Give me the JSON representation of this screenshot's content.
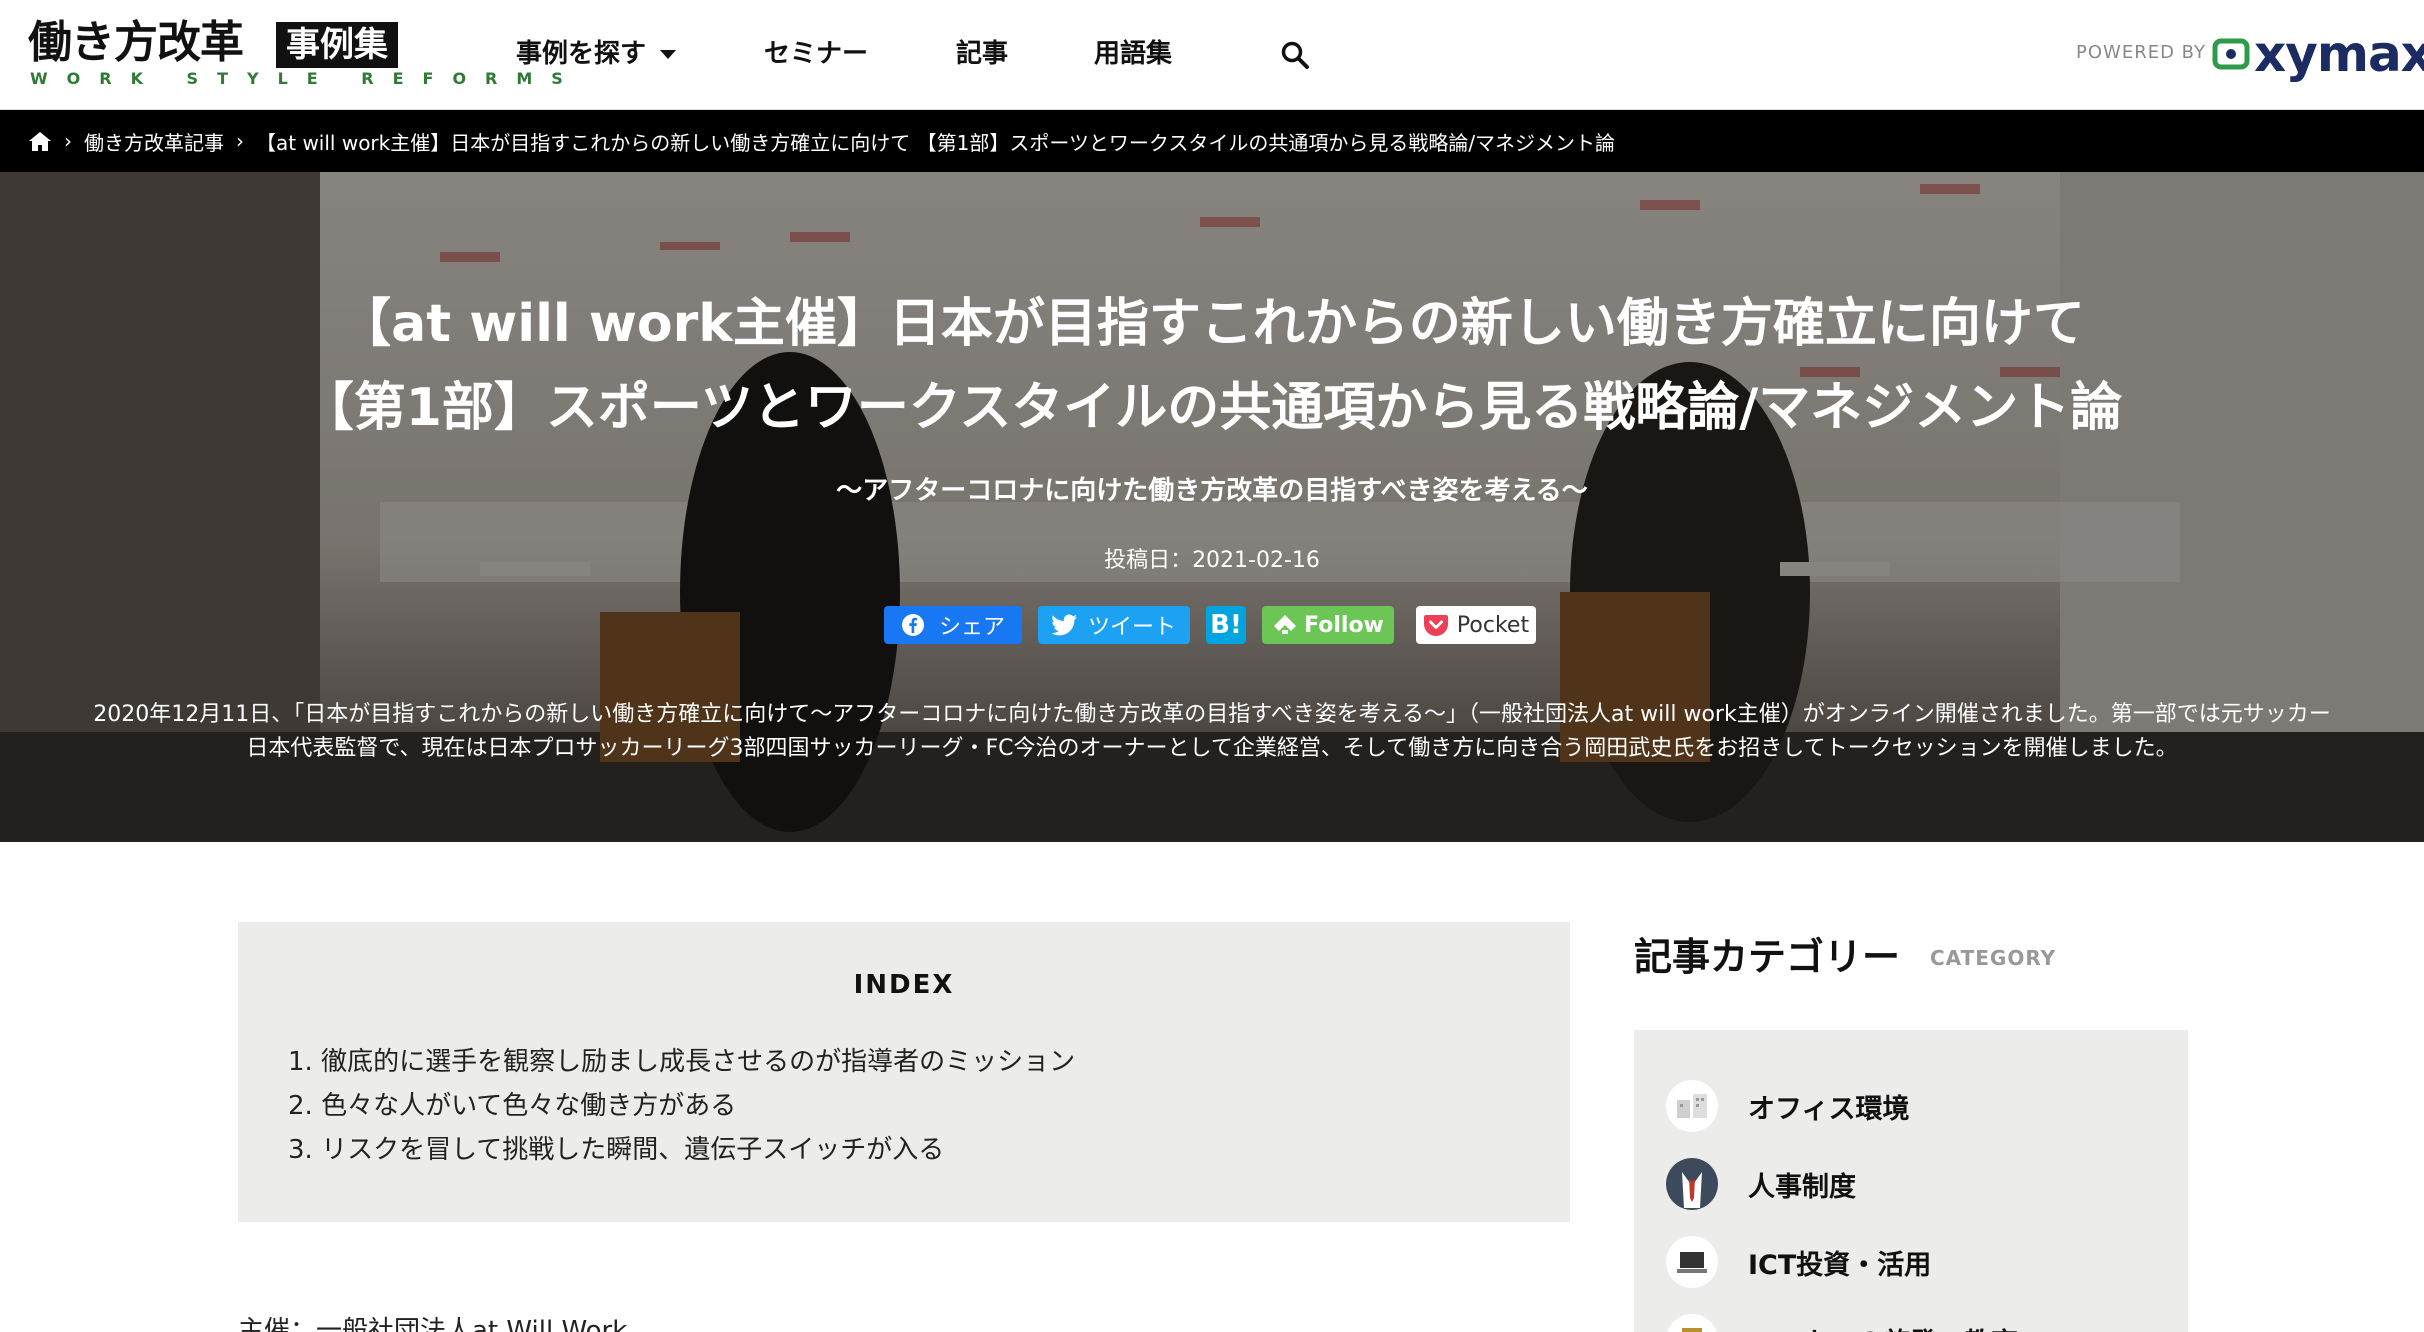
{
  "header": {
    "logo_main": "働き方改革",
    "logo_badge": "事例集",
    "logo_sub": "WORK STYLE REFORMS",
    "nav": [
      {
        "label": "事例を探す",
        "has_dropdown": true
      },
      {
        "label": "セミナー"
      },
      {
        "label": "記事"
      },
      {
        "label": "用語集"
      }
    ],
    "search_icon": "search-icon",
    "powered_by": "POWERED BY",
    "brand": "xymax"
  },
  "breadcrumb": {
    "home_icon": "home-icon",
    "items": [
      "働き方改革記事",
      "【at will work主催】日本が目指すこれからの新しい働き方確立に向けて 【第1部】スポーツとワークスタイルの共通項から見る戦略論/マネジメント論"
    ]
  },
  "hero": {
    "title_line1": "【at will work主催】日本が目指すこれからの新しい働き方確立に向けて",
    "title_line2": "【第1部】スポーツとワークスタイルの共通項から見る戦略論/マネジメント論",
    "subtitle": "〜アフターコロナに向けた働き方改革の目指すべき姿を考える〜",
    "date": "投稿日：2021-02-16",
    "share": {
      "facebook": "シェア",
      "twitter": "ツイート",
      "hatena": "B!",
      "feedly": "Follow",
      "pocket": "Pocket"
    },
    "lead": "2020年12月11日、「日本が目指すこれからの新しい働き方確立に向けて〜アフターコロナに向けた働き方改革の目指すべき姿を考える〜」（一般社団法人at will work主催）がオンライン開催されました。第一部では元サッカー日本代表監督で、現在は日本プロサッカーリーグ3部四国サッカーリーグ・FC今治のオーナーとして企業経営、そして働き方に向き合う岡田武史氏をお招きしてトークセッションを開催しました。"
  },
  "index": {
    "title": "INDEX",
    "items": [
      "1. 徹底的に選手を観察し励まし成長させるのが指導者のミッション",
      "2. 色々な人がいて色々な働き方がある",
      "3. リスクを冒して挑戦した瞬間、遺伝子スイッチが入る"
    ]
  },
  "organizer": "主催：一般社団法人at Will Work",
  "sidebar": {
    "title": "記事カテゴリー",
    "subtitle": "CATEGORY",
    "categories": [
      {
        "label": "オフィス環境",
        "icon": "office-icon"
      },
      {
        "label": "人事制度",
        "icon": "suit-icon"
      },
      {
        "label": "ICT投資・活用",
        "icon": "laptop-icon"
      },
      {
        "label": "ワーカーの啓発・教育",
        "icon": "book-icon"
      }
    ]
  },
  "colors": {
    "facebook": "#1877f2",
    "twitter": "#1da1f2",
    "hatena": "#00a4de",
    "feedly": "#6cc655",
    "pocket": "#ef3f56",
    "logo_green": "#2f7a35",
    "brand_navy": "#1d2b63"
  }
}
